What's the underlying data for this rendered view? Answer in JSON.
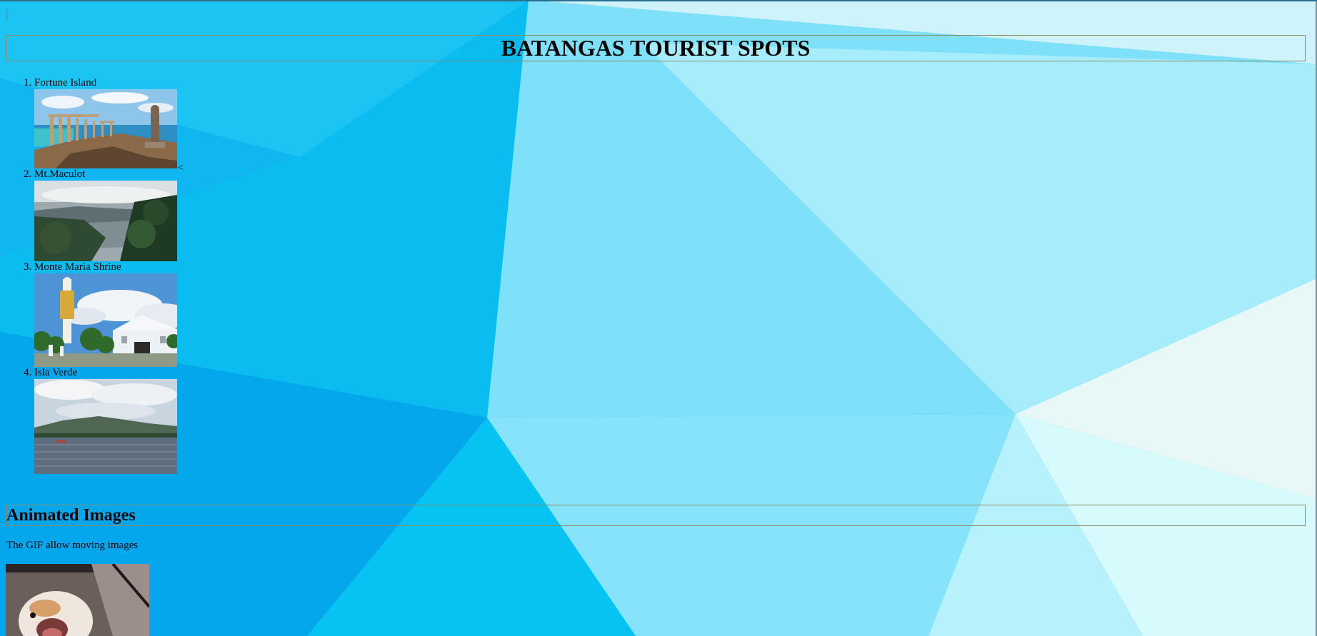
{
  "page": {
    "title": "BATANGAS TOURIST SPOTS",
    "cursor_glyph": "|"
  },
  "spots": [
    {
      "label": "Fortune Island",
      "image_icon": "fortune-island-photo"
    },
    {
      "label": "Mt.Maculot",
      "image_icon": "mt-maculot-photo"
    },
    {
      "label": "Monte Maria Shrine",
      "image_icon": "monte-maria-shrine-photo"
    },
    {
      "label": "Isla Verde",
      "image_icon": "isla-verde-photo"
    }
  ],
  "stray_text": "<",
  "animated": {
    "heading": "Animated Images",
    "description": "The GIF allow moving images",
    "image_icon": "animated-gif-photo"
  },
  "colors": {
    "background_primary": "#00b6ee",
    "background_light": "#aeeefc",
    "border": "#8a8a6a"
  }
}
